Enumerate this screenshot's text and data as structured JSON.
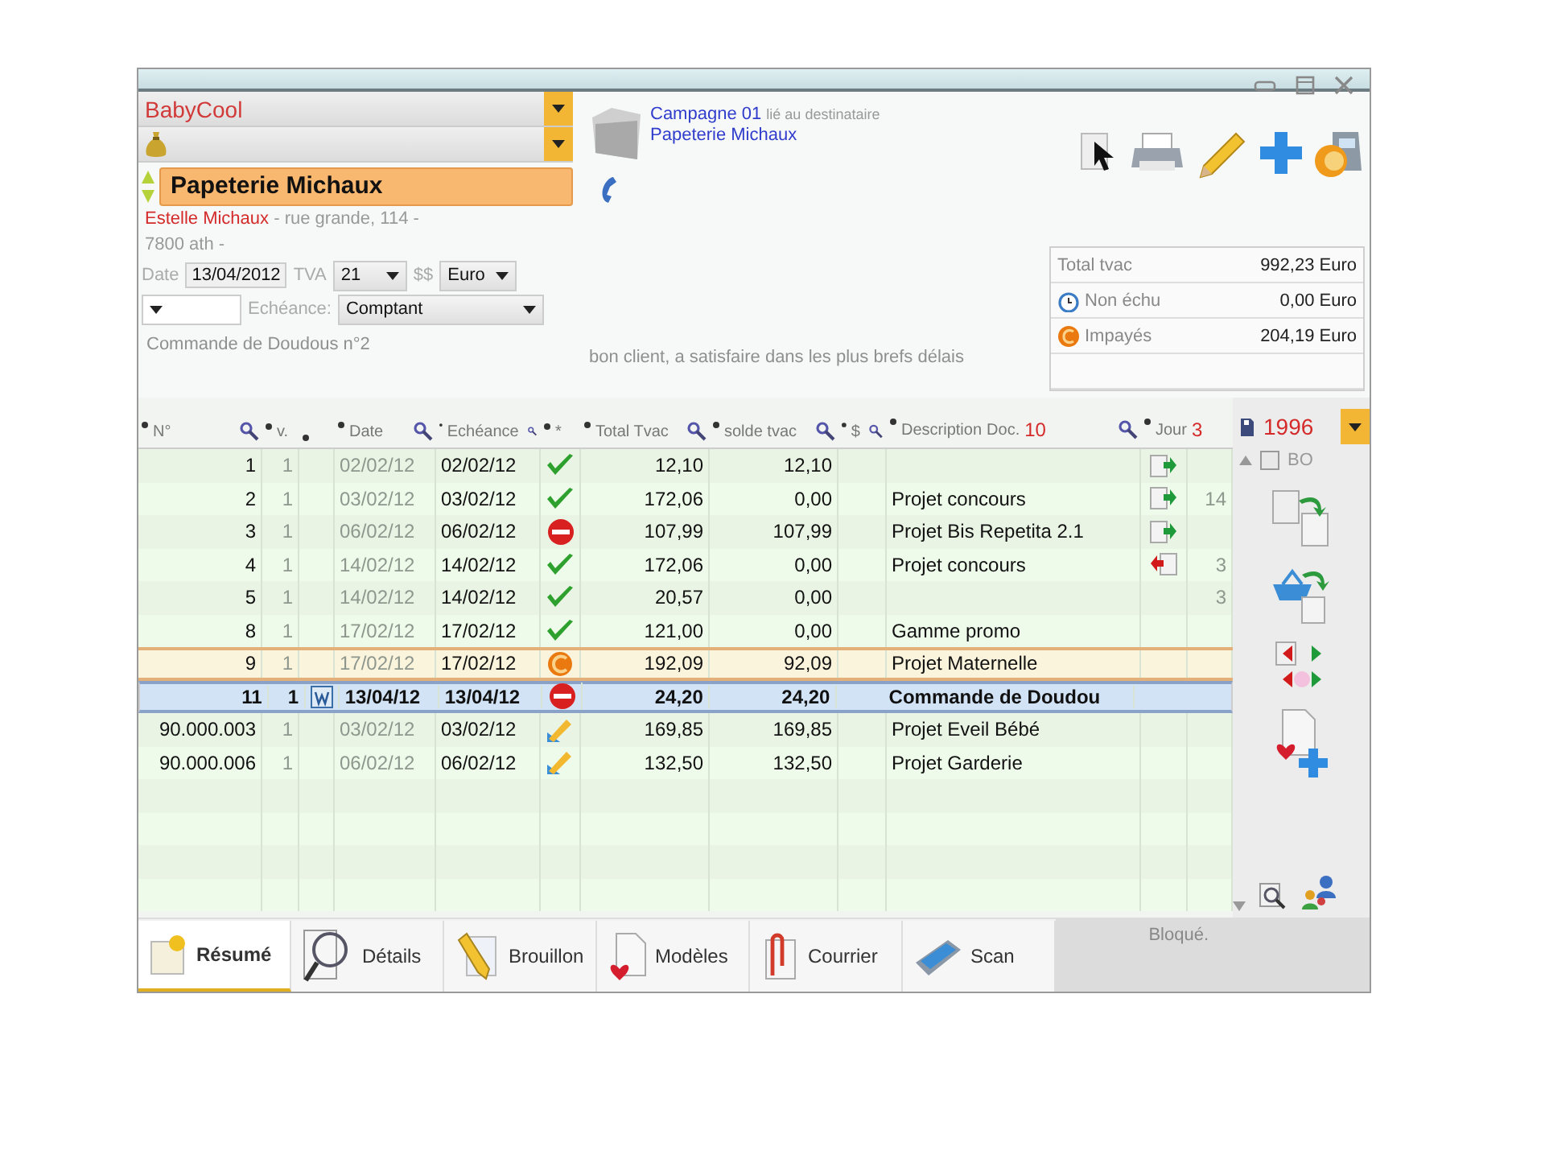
{
  "client": {
    "company": "BabyCool",
    "name": "Papeterie Michaux",
    "contact": "Estelle Michaux",
    "address_lines": [
      "- rue grande, 114 -",
      "7800 ath -"
    ]
  },
  "form": {
    "date_label": "Date",
    "date": "13/04/2012",
    "tva_label": "TVA",
    "tva": "21",
    "currency_label": "$$",
    "currency": "Euro",
    "due_label": "Echéance:",
    "due": "Comptant",
    "reference": "Commande de Doudous n°2"
  },
  "campaign": {
    "name": "Campagne 01",
    "note": "lié au destinataire",
    "recipient": "Papeterie Michaux"
  },
  "comment": "bon client, a satisfaire dans les plus brefs délais",
  "summary": [
    {
      "label": "Total tvac",
      "value": "992,23 Euro",
      "kind": "total"
    },
    {
      "label": "Non échu",
      "value": "0,00 Euro",
      "kind": "pending"
    },
    {
      "label": "Impayés",
      "value": "204,19 Euro",
      "kind": "unpaid"
    }
  ],
  "columns": [
    {
      "label": "N°",
      "search": true
    },
    {
      "label": "v.",
      "search": false
    },
    {
      "search": false
    },
    {
      "label": "Date",
      "search": true
    },
    {
      "label": "Echéance",
      "search": true
    },
    {
      "label": "*",
      "search": false
    },
    {
      "label": "Total Tvac",
      "search": true
    },
    {
      "label": "solde tvac",
      "search": true
    },
    {
      "label": "$",
      "search": true
    },
    {
      "label": "Description",
      "extra": "Doc.",
      "count": "10",
      "search": true
    },
    {
      "label": "Jour",
      "count": "3",
      "search": false
    }
  ],
  "rows": [
    {
      "n": "1",
      "v": "1",
      "word": false,
      "date": "02/02/12",
      "due": "02/02/12",
      "status": {
        "kind": "paid"
      },
      "total": "12,10",
      "solde": "12,10",
      "doc": {
        "kind": "in"
      },
      "selected": false,
      "focused": false
    },
    {
      "n": "2",
      "v": "1",
      "word": false,
      "date": "03/02/12",
      "due": "03/02/12",
      "status": {
        "kind": "paid"
      },
      "total": "172,06",
      "solde": "0,00",
      "description": "Projet concours",
      "doc": {
        "kind": "in"
      },
      "jour": "14",
      "selected": false,
      "focused": false
    },
    {
      "n": "3",
      "v": "1",
      "word": false,
      "date": "06/02/12",
      "due": "06/02/12",
      "status": {
        "kind": "blocked"
      },
      "total": "107,99",
      "solde": "107,99",
      "description": "Projet Bis Repetita 2.1",
      "doc": {
        "kind": "in"
      },
      "selected": false,
      "focused": false
    },
    {
      "n": "4",
      "v": "1",
      "word": false,
      "date": "14/02/12",
      "due": "14/02/12",
      "status": {
        "kind": "paid"
      },
      "total": "172,06",
      "solde": "0,00",
      "description": "Projet concours",
      "doc": {
        "kind": "out"
      },
      "jour": "3",
      "selected": false,
      "focused": false
    },
    {
      "n": "5",
      "v": "1",
      "word": false,
      "date": "14/02/12",
      "due": "14/02/12",
      "status": {
        "kind": "paid"
      },
      "total": "20,57",
      "solde": "0,00",
      "jour": "3",
      "selected": false,
      "focused": false
    },
    {
      "n": "8",
      "v": "1",
      "word": false,
      "date": "17/02/12",
      "due": "17/02/12",
      "status": {
        "kind": "paid"
      },
      "total": "121,00",
      "solde": "0,00",
      "description": "Gamme promo",
      "selected": false,
      "focused": false
    },
    {
      "n": "9",
      "v": "1",
      "word": false,
      "date": "17/02/12",
      "due": "17/02/12",
      "status": {
        "kind": "unpaid"
      },
      "total": "192,09",
      "solde": "92,09",
      "description": "Projet Maternelle",
      "selected": false,
      "focused": true
    },
    {
      "n": "11",
      "v": "1",
      "word": true,
      "date": "13/04/12",
      "due": "13/04/12",
      "status": {
        "kind": "blocked"
      },
      "total": "24,20",
      "solde": "24,20",
      "description": "Commande de Doudou",
      "selected": true,
      "focused": false
    },
    {
      "n": "90.000.003",
      "v": "1",
      "word": false,
      "date": "03/02/12",
      "due": "03/02/12",
      "status": {
        "kind": "draft"
      },
      "total": "169,85",
      "solde": "169,85",
      "description": "Projet Eveil Bébé",
      "selected": false,
      "focused": false
    },
    {
      "n": "90.000.006",
      "v": "1",
      "word": false,
      "date": "06/02/12",
      "due": "06/02/12",
      "status": {
        "kind": "draft"
      },
      "total": "132,50",
      "solde": "132,50",
      "description": "Projet Garderie",
      "selected": false,
      "focused": false
    }
  ],
  "sidebar": {
    "year": "1996",
    "bo_label": "BO",
    "bo_checked": false
  },
  "tabs": [
    {
      "label": "Résumé",
      "selected": true
    },
    {
      "label": "Détails",
      "selected": false
    },
    {
      "label": "Brouillon",
      "selected": false
    },
    {
      "label": "Modèles",
      "selected": false
    },
    {
      "label": "Courrier",
      "selected": false
    },
    {
      "label": "Scan",
      "selected": false
    }
  ],
  "status": "Bloqué."
}
